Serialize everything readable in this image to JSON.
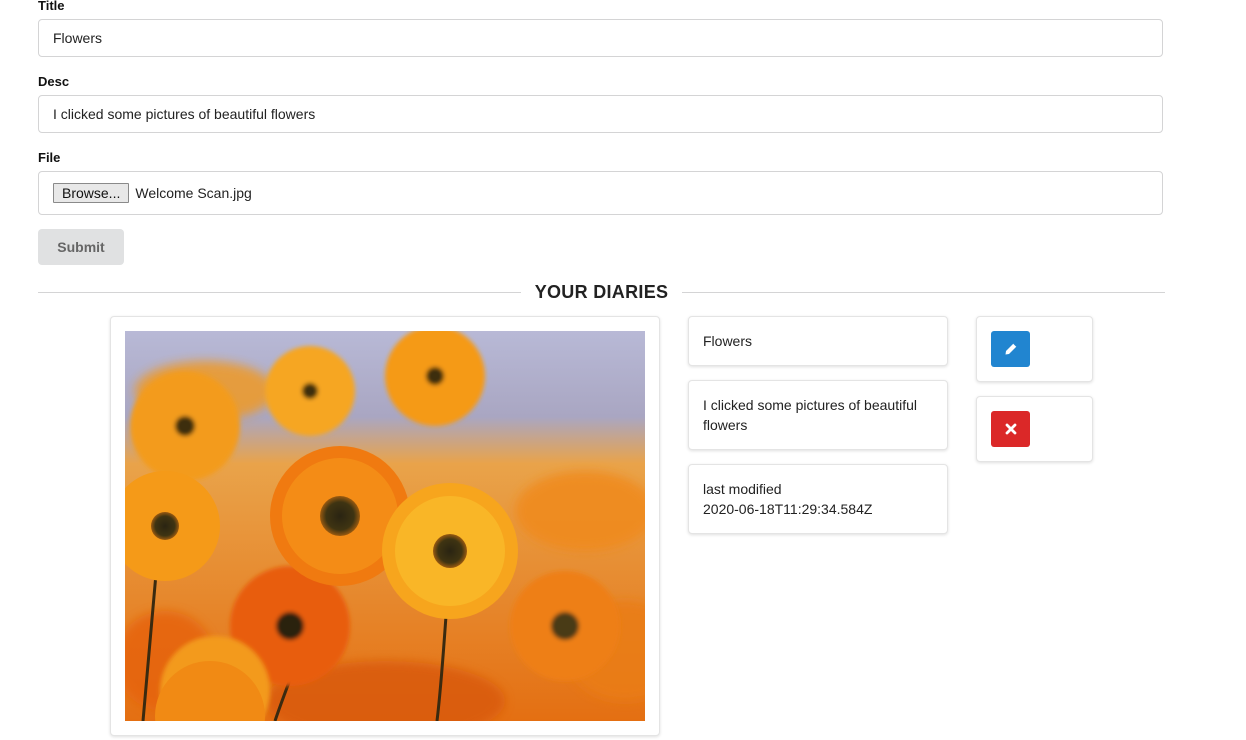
{
  "form": {
    "title_label": "Title",
    "title_value": "Flowers",
    "desc_label": "Desc",
    "desc_value": "I clicked some pictures of beautiful flowers",
    "file_label": "File",
    "browse_label": "Browse...",
    "file_name": "Welcome Scan.jpg",
    "submit_label": "Submit"
  },
  "section": {
    "heading": "YOUR DIARIES"
  },
  "diary": {
    "image_subject": "orange-daisy-flowers",
    "title": "Flowers",
    "description": "I clicked some pictures of beautiful flowers",
    "modified_label": "last modified",
    "modified_value": "2020-06-18T11:29:34.584Z",
    "edit_icon": "pencil-icon",
    "delete_icon": "close-icon"
  },
  "colors": {
    "edit": "#2185d0",
    "delete": "#db2828",
    "divider": "#d4d4d5"
  }
}
